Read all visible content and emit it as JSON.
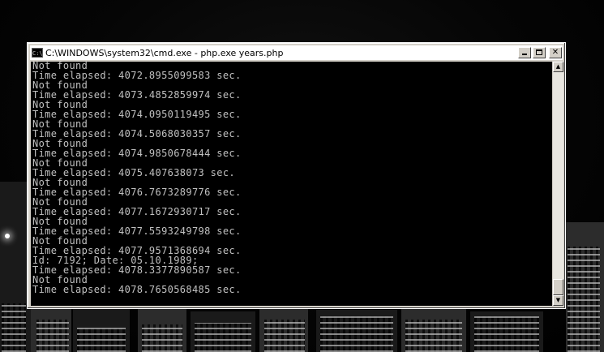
{
  "window": {
    "title": "C:\\WINDOWS\\system32\\cmd.exe - php.exe years.php",
    "icon_text": "C:\\",
    "icon": "cmd-icon",
    "controls": {
      "minimize": "minimize-icon",
      "maximize": "maximize-icon",
      "close": "close-icon",
      "close_glyph": "✕"
    }
  },
  "console": {
    "lines": [
      "Not found",
      "Time elapsed: 4072.8955099583 sec.",
      "Not found",
      "Time elapsed: 4073.4852859974 sec.",
      "Not found",
      "Time elapsed: 4074.0950119495 sec.",
      "Not found",
      "Time elapsed: 4074.5068030357 sec.",
      "Not found",
      "Time elapsed: 4074.9850678444 sec.",
      "Not found",
      "Time elapsed: 4075.407638073 sec.",
      "Not found",
      "Time elapsed: 4076.7673289776 sec.",
      "Not found",
      "Time elapsed: 4077.1672930717 sec.",
      "Not found",
      "Time elapsed: 4077.5593249798 sec.",
      "Not found",
      "Time elapsed: 4077.9571368694 sec.",
      "Id: 7192; Date: 05.10.1989;",
      "Time elapsed: 4078.3377890587 sec.",
      "Not found",
      "Time elapsed: 4078.7650568485 sec."
    ],
    "text_color": "#c0c0c0",
    "background": "#000000"
  },
  "scrollbar": {
    "up_glyph": "▲",
    "down_glyph": "▼",
    "position": "bottom"
  },
  "colors": {
    "titlebar": "#ffffff",
    "chrome": "#d4d0c8"
  }
}
